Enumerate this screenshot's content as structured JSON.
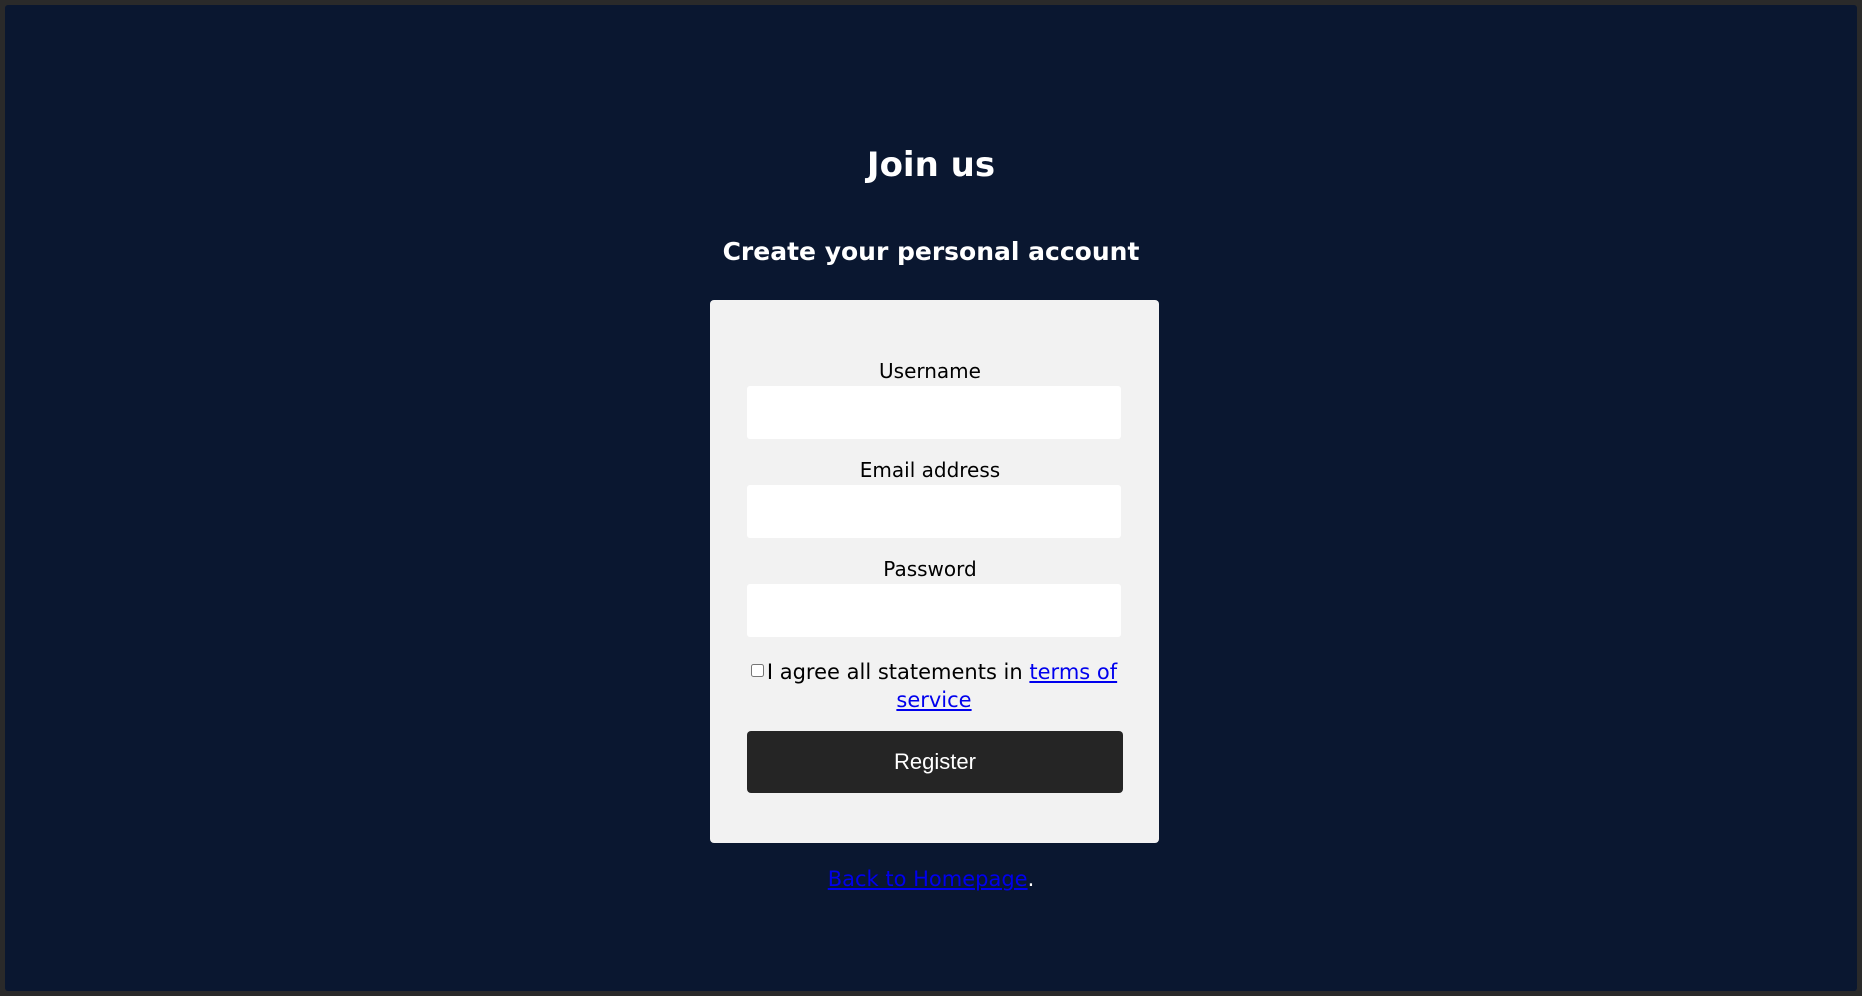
{
  "page": {
    "title": "Join us",
    "subtitle": "Create your personal account"
  },
  "form": {
    "username_label": "Username",
    "username_value": "",
    "email_label": "Email address",
    "email_value": "",
    "password_label": "Password",
    "password_value": "",
    "terms_checked": false,
    "terms_text": "I agree all statements in",
    "terms_link": "terms of service",
    "register_label": "Register"
  },
  "footer": {
    "back_link": "Back to Homepage",
    "back_suffix": "."
  },
  "colors": {
    "background": "#0a1730",
    "card": "#f2f2f2",
    "button": "#252525",
    "link": "#0000ee"
  }
}
